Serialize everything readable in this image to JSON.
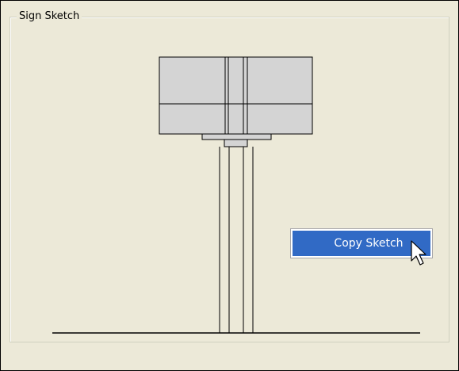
{
  "groupbox": {
    "title": "Sign Sketch"
  },
  "context_menu": {
    "items": [
      {
        "label": "Copy Sketch"
      }
    ]
  },
  "colors": {
    "background": "#ECE9D8",
    "sign_panel_fill": "#D4D4D4",
    "menu_highlight": "#316AC5",
    "menu_text": "#FFFFFF"
  },
  "icons": {
    "cursor": "arrow-pointer-icon"
  }
}
